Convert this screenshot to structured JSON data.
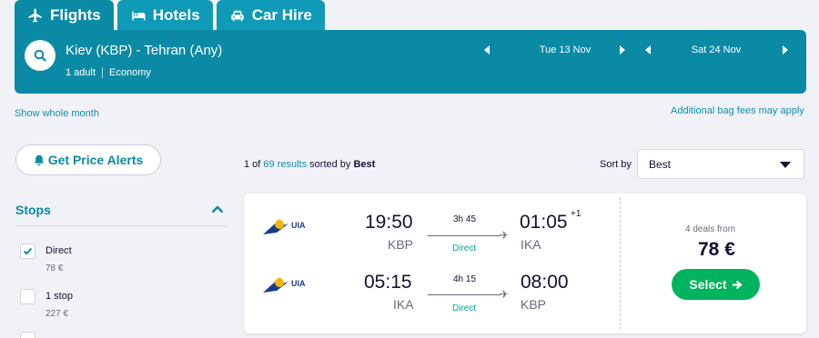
{
  "tabs": [
    {
      "label": "Flights",
      "icon": "plane-icon",
      "active": true
    },
    {
      "label": "Hotels",
      "icon": "bed-icon",
      "active": false
    },
    {
      "label": "Car Hire",
      "icon": "car-icon",
      "active": false
    }
  ],
  "search": {
    "route": "Kiev (KBP) - Tehran (Any)",
    "passengers": "1 adult",
    "cabin": "Economy",
    "depart_date": "Tue 13 Nov",
    "return_date": "Sat 24 Nov"
  },
  "links": {
    "whole_month": "Show whole month",
    "bag_fees": "Additional bag fees may apply"
  },
  "alerts_button": "Get Price Alerts",
  "filters": {
    "stops_title": "Stops",
    "options": [
      {
        "label": "Direct",
        "price": "78 €",
        "checked": true
      },
      {
        "label": "1 stop",
        "price": "227 €",
        "checked": false
      }
    ]
  },
  "results": {
    "prefix": "1 of ",
    "count_link": "69 results",
    "middle": " sorted by ",
    "sorted_by": "Best",
    "sort_label": "Sort by",
    "sort_value": "Best"
  },
  "card": {
    "airline": "UIA",
    "legs": [
      {
        "dep_time": "19:50",
        "dep_code": "KBP",
        "duration": "3h 45",
        "stops": "Direct",
        "arr_time": "01:05",
        "arr_code": "IKA",
        "day_offset": "+1"
      },
      {
        "dep_time": "05:15",
        "dep_code": "IKA",
        "duration": "4h 15",
        "stops": "Direct",
        "arr_time": "08:00",
        "arr_code": "KBP",
        "day_offset": ""
      }
    ],
    "deals": "4 deals from",
    "price": "78 €",
    "select_label": "Select"
  },
  "colors": {
    "brand": "#0b8aa6",
    "select": "#00b35e",
    "direct": "#00a698"
  }
}
